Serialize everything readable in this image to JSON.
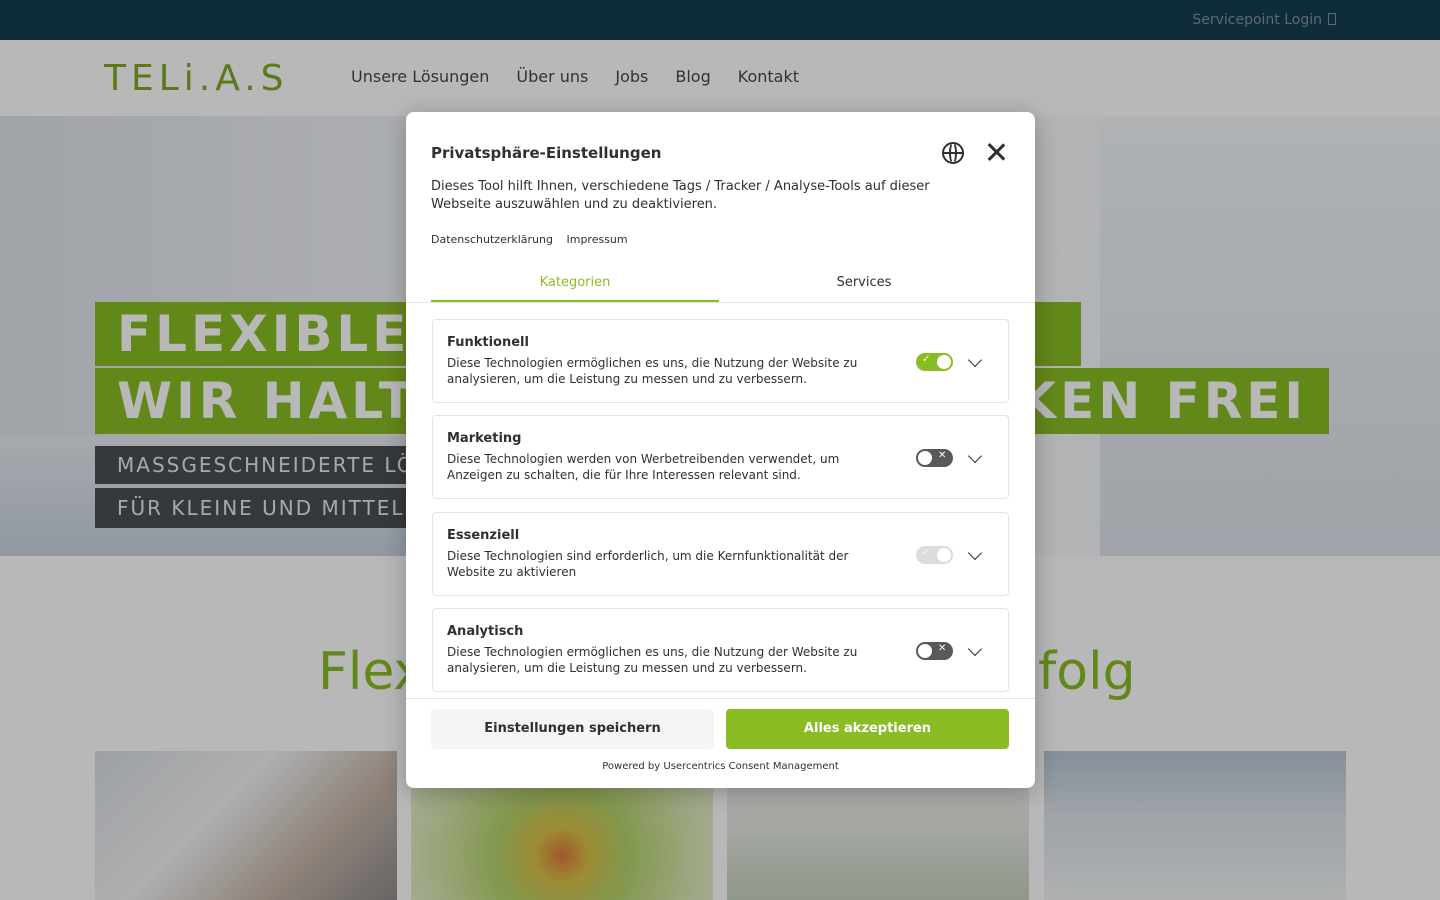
{
  "topbar": {
    "login_label": "Servicepoint Login"
  },
  "header": {
    "logo_text": "TELi.A.S",
    "nav": [
      "Unsere Lösungen",
      "Über uns",
      "Jobs",
      "Blog",
      "Kontakt"
    ]
  },
  "hero": {
    "band1": "FLEXIBLE",
    "band2_left": "WIR HALT",
    "band2_right": "KEN FREI",
    "sub1": "MASSGESCHNEIDERTE LÖS",
    "sub2": "FÜR KLEINE UND MITTELST"
  },
  "section": {
    "title_left": "Flex",
    "title_right": "folg"
  },
  "modal": {
    "title": "Privatsphäre-Einstellungen",
    "description": "Dieses Tool hilft Ihnen, verschiedene Tags / Tracker / Analyse-Tools auf dieser Webseite auszuwählen und zu deaktivieren.",
    "links": [
      "Datenschutzerklärung",
      "Impressum"
    ],
    "tabs": {
      "active": "Kategorien",
      "inactive": "Services"
    },
    "categories": [
      {
        "title": "Funktionell",
        "description": "Diese Technologien ermöglichen es uns, die Nutzung der Website zu analysieren, um die Leistung zu messen und zu verbessern.",
        "state": "on"
      },
      {
        "title": "Marketing",
        "description": "Diese Technologien werden von Werbetreibenden verwendet, um Anzeigen zu schalten, die für Ihre Interessen relevant sind.",
        "state": "off"
      },
      {
        "title": "Essenziell",
        "description": "Diese Technologien sind erforderlich, um die Kernfunktionalität der Website zu aktivieren",
        "state": "disabled"
      },
      {
        "title": "Analytisch",
        "description": "Diese Technologien ermöglichen es uns, die Nutzung der Website zu analysieren, um die Leistung zu messen und zu verbessern.",
        "state": "off"
      }
    ],
    "save_label": "Einstellungen speichern",
    "accept_label": "Alles akzeptieren",
    "powered_by": "Powered by Usercentrics Consent Management"
  },
  "colors": {
    "accent": "#8abd24",
    "topbar": "#163d50",
    "text": "#303030"
  },
  "icons": {
    "language": "globe-icon",
    "close": "close-icon",
    "expand": "chevron-down-icon"
  }
}
